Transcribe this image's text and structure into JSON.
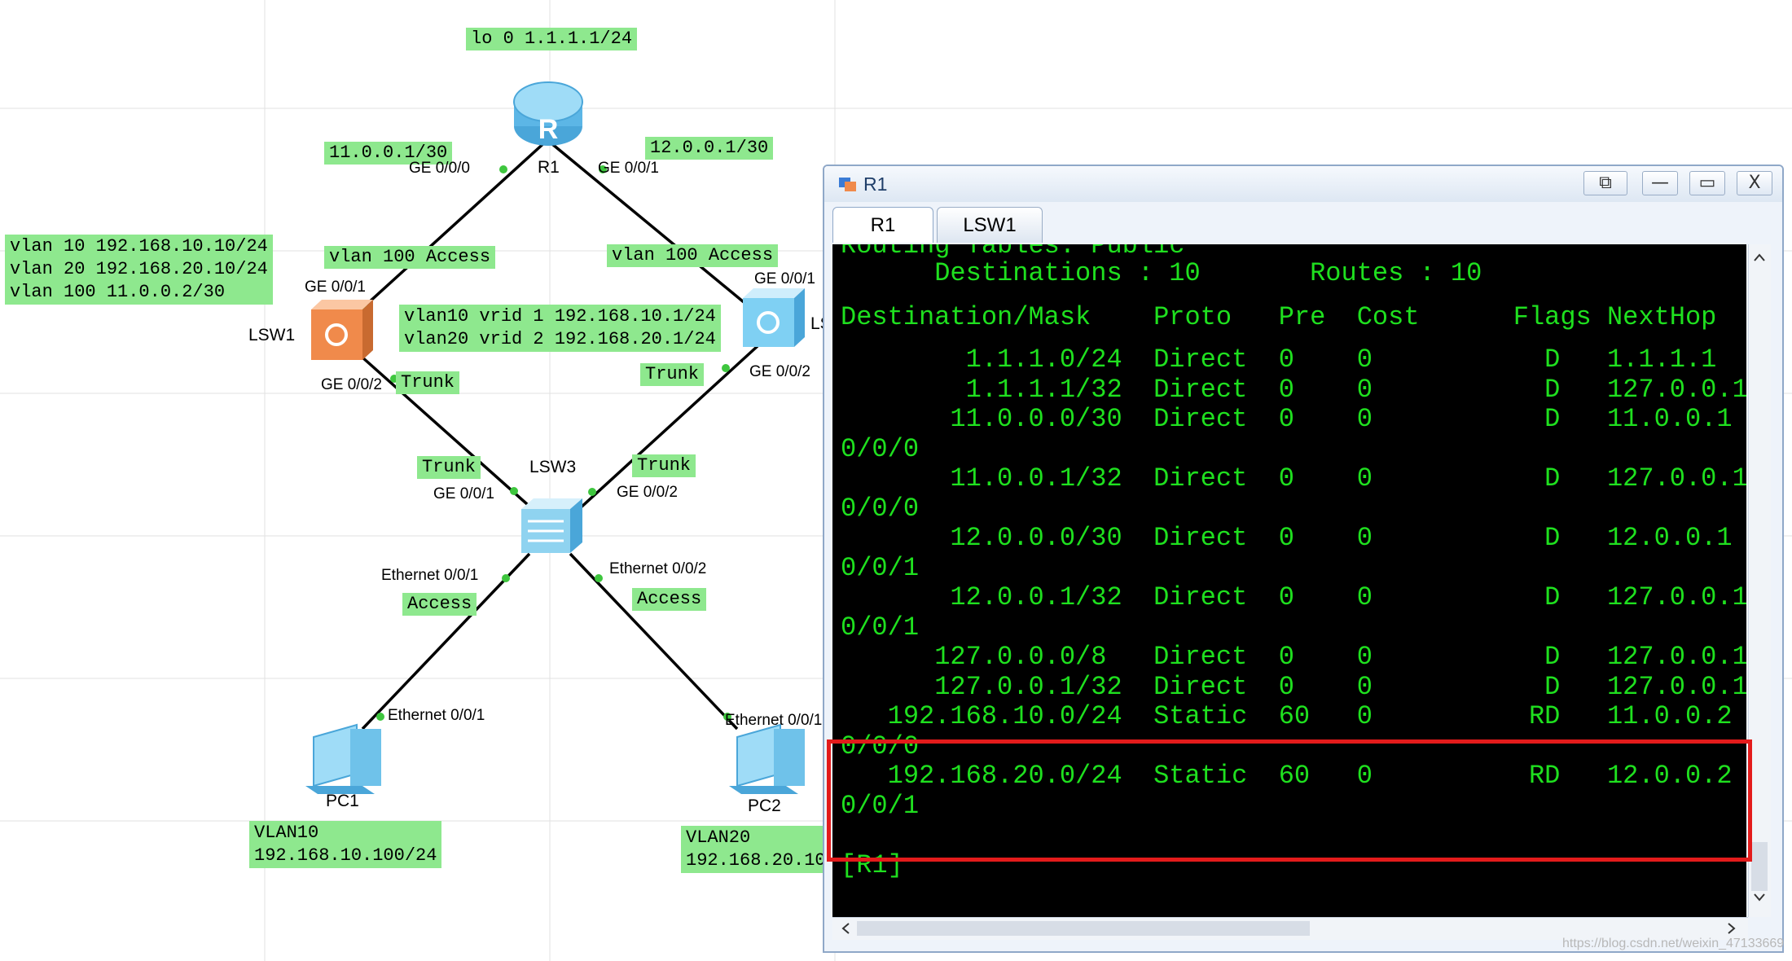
{
  "topology": {
    "loopback_label": "lo 0 1.1.1.1/24",
    "r1_name": "R1",
    "lsw1_name": "LSW1",
    "lsw2_name_partial": "LS",
    "lsw3_name": "LSW3",
    "pc1_name": "PC1",
    "pc2_name": "PC2",
    "r1_ge000_ip": "11.0.0.1/30",
    "r1_ge001_ip": "12.0.0.1/30",
    "r1_ge000_port": "GE 0/0/0",
    "r1_ge001_port": "GE 0/0/1",
    "lsw1_vlan_config": [
      "vlan 10 192.168.10.10/24",
      "vlan 20 192.168.20.10/24",
      "vlan 100 11.0.0.2/30"
    ],
    "lsw1_uplink_mode": "vlan 100 Access",
    "lsw2_uplink_mode": "vlan 100 Access",
    "vrrp_config": [
      "vlan10 vrid 1 192.168.10.1/24",
      "vlan20 vrid 2 192.168.20.1/24"
    ],
    "lsw1_ge001": "GE 0/0/1",
    "lsw1_ge002": "GE 0/0/2",
    "lsw2_ge001": "GE 0/0/1",
    "lsw2_ge002": "GE 0/0/2",
    "lsw1_down_mode": "Trunk",
    "lsw2_down_mode": "Trunk",
    "lsw3_left_mode": "Trunk",
    "lsw3_right_mode": "Trunk",
    "lsw3_ge001": "GE 0/0/1",
    "lsw3_ge002": "GE 0/0/2",
    "lsw3_eth001": "Ethernet 0/0/1",
    "lsw3_eth002": "Ethernet 0/0/2",
    "lsw3_access_left": "Access",
    "lsw3_access_right": "Access",
    "pc1_eth": "Ethernet 0/0/1",
    "pc2_eth": "Ethernet 0/0/1",
    "pc1_vlan": "VLAN10",
    "pc1_ip": "192.168.10.100/24",
    "pc2_vlan": "VLAN20",
    "pc2_ip_partial": "192.168.20.10"
  },
  "window": {
    "title": "R1",
    "tabs": [
      {
        "label": "R1",
        "active": true
      },
      {
        "label": "LSW1",
        "active": false
      }
    ],
    "buttons": {
      "restore": "⧉",
      "minimize": "—",
      "maximize": "▭",
      "close": "X"
    }
  },
  "console": {
    "cut_header": "Routing Tables: Public",
    "summary": "      Destinations : 10       Routes : 10",
    "header": "Destination/Mask    Proto   Pre  Cost      Flags NextHop",
    "lines": [
      "        1.1.1.0/24  Direct  0    0           D   1.1.1.1",
      "        1.1.1.1/32  Direct  0    0           D   127.0.0.1",
      "       11.0.0.0/30  Direct  0    0           D   11.0.0.1",
      "0/0/0",
      "       11.0.0.1/32  Direct  0    0           D   127.0.0.1",
      "0/0/0",
      "       12.0.0.0/30  Direct  0    0           D   12.0.0.1",
      "0/0/1",
      "       12.0.0.1/32  Direct  0    0           D   127.0.0.1",
      "0/0/1",
      "      127.0.0.0/8   Direct  0    0           D   127.0.0.1",
      "      127.0.0.1/32  Direct  0    0           D   127.0.0.1",
      "   192.168.10.0/24  Static  60   0          RD   11.0.0.2",
      "0/0/0",
      "   192.168.20.0/24  Static  60   0          RD   12.0.0.2",
      "0/0/1",
      "",
      "[R1]"
    ]
  },
  "watermark": "https://blog.csdn.net/weixin_47133669",
  "colors": {
    "label_bg": "#8ee88e",
    "terminal_text": "#1fe01f",
    "highlight": "#e31b1b"
  }
}
